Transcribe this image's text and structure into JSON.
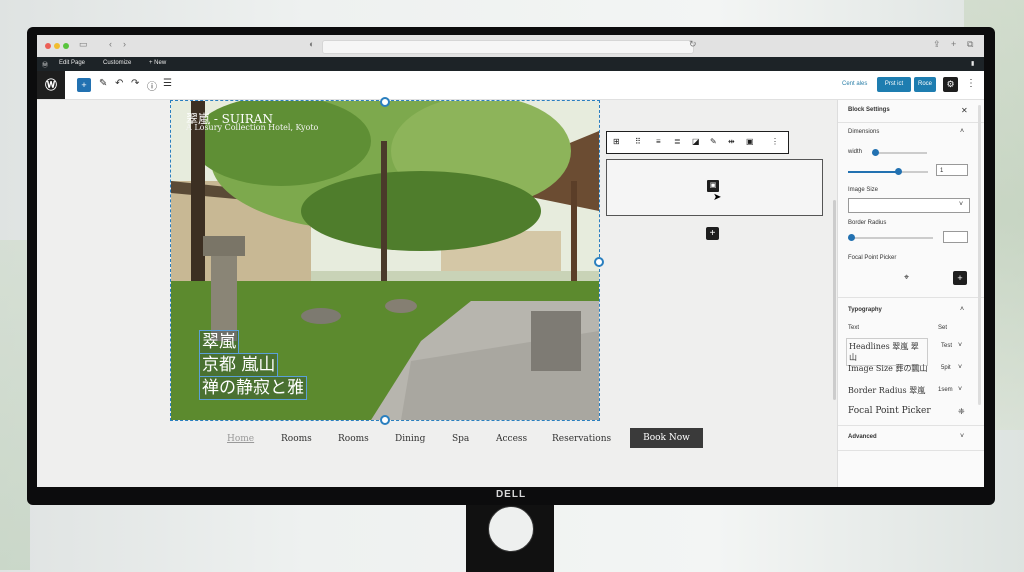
{
  "brand": {
    "monitor": "DELL"
  },
  "adminbar": {
    "edit_page": "Edit Page",
    "customize": "Customize",
    "new": "+ New"
  },
  "toolbar": {
    "save_draft": "Cent ales",
    "preview": "Prst ict",
    "publish": "Roce"
  },
  "hero": {
    "title": "翠嵐 - SUIRAN",
    "subtitle": "A Losury Collection Hotel, Kyoto",
    "jp_lines": [
      "翠嵐",
      "京都 嵐山",
      "禅の静寂と雅"
    ]
  },
  "nav": {
    "items": [
      "Home",
      "Rooms",
      "Rooms",
      "Dining",
      "Spa",
      "Access",
      "Reservations"
    ],
    "cta": "Book Now"
  },
  "sidebar": {
    "title": "Block Settings",
    "dimensions": "Dimensions",
    "width_label": "width",
    "width_value": "1",
    "image_size": "Image Size",
    "border_radius": "Border Radius",
    "focal_point": "Focal Point Picker",
    "typography": "Typography",
    "text_label": "Text",
    "set_label": "Set",
    "typo_rows": [
      {
        "label": "Headlines 翠嵐 翠山",
        "value": "Test"
      },
      {
        "label": "Image Size 葬の飄山",
        "value": "5pit"
      },
      {
        "label": "Border Radius 翠嵐",
        "value": "1sem"
      },
      {
        "label": "Focal Point Picker",
        "value": ""
      }
    ],
    "advanced": "Advanced"
  },
  "icons": {
    "wp": "wordpress-icon",
    "add": "plus-icon",
    "gear": "gear-icon",
    "close": "close-icon",
    "chevron": "chevron-down-icon"
  },
  "colors": {
    "accent": "#2271b1",
    "dark": "#1e1e1e",
    "cta": "#3a3a3a"
  }
}
